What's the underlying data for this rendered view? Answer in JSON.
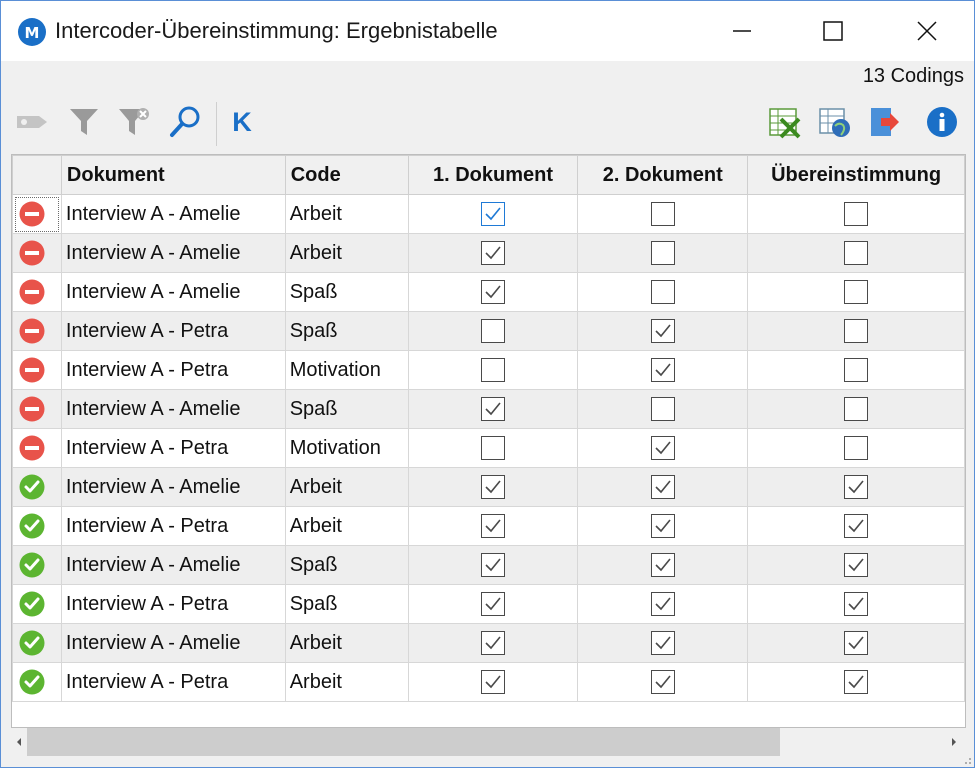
{
  "window": {
    "title": "Intercoder-Übereinstimmung: Ergebnistabelle",
    "app_icon": "maxqda-logo-icon",
    "accent": "#1a6fc7"
  },
  "status": {
    "codings_count": "13 Codings"
  },
  "toolbar": {
    "left_icons": [
      "tag-icon",
      "filter-icon",
      "clear-filter-icon",
      "search-icon",
      "kappa-icon"
    ],
    "kappa_label": "K",
    "right_icons": [
      "export-excel-icon",
      "export-web-icon",
      "export-arrow-icon",
      "info-icon"
    ]
  },
  "table": {
    "columns": [
      "",
      "Dokument",
      "Code",
      "1. Dokument",
      "2. Dokument",
      "Übereinstimmung"
    ],
    "rows": [
      {
        "status": "mismatch",
        "document": "Interview A - Amelie",
        "code": "Arbeit",
        "doc1": true,
        "doc2": false,
        "match": false
      },
      {
        "status": "mismatch",
        "document": "Interview A - Amelie",
        "code": "Arbeit",
        "doc1": true,
        "doc2": false,
        "match": false
      },
      {
        "status": "mismatch",
        "document": "Interview A - Amelie",
        "code": "Spaß",
        "doc1": true,
        "doc2": false,
        "match": false
      },
      {
        "status": "mismatch",
        "document": "Interview A - Petra",
        "code": "Spaß",
        "doc1": false,
        "doc2": true,
        "match": false
      },
      {
        "status": "mismatch",
        "document": "Interview A - Petra",
        "code": "Motivation",
        "doc1": false,
        "doc2": true,
        "match": false
      },
      {
        "status": "mismatch",
        "document": "Interview A - Amelie",
        "code": "Spaß",
        "doc1": true,
        "doc2": false,
        "match": false
      },
      {
        "status": "mismatch",
        "document": "Interview A - Petra",
        "code": "Motivation",
        "doc1": false,
        "doc2": true,
        "match": false
      },
      {
        "status": "match",
        "document": "Interview A - Amelie",
        "code": "Arbeit",
        "doc1": true,
        "doc2": true,
        "match": true
      },
      {
        "status": "match",
        "document": "Interview A - Petra",
        "code": "Arbeit",
        "doc1": true,
        "doc2": true,
        "match": true
      },
      {
        "status": "match",
        "document": "Interview A - Amelie",
        "code": "Spaß",
        "doc1": true,
        "doc2": true,
        "match": true
      },
      {
        "status": "match",
        "document": "Interview A - Petra",
        "code": "Spaß",
        "doc1": true,
        "doc2": true,
        "match": true
      },
      {
        "status": "match",
        "document": "Interview A - Amelie",
        "code": "Arbeit",
        "doc1": true,
        "doc2": true,
        "match": true
      },
      {
        "status": "match",
        "document": "Interview A - Petra",
        "code": "Arbeit",
        "doc1": true,
        "doc2": true,
        "match": true
      }
    ],
    "colors": {
      "mismatch": "#e8534a",
      "match": "#5cb531"
    }
  }
}
